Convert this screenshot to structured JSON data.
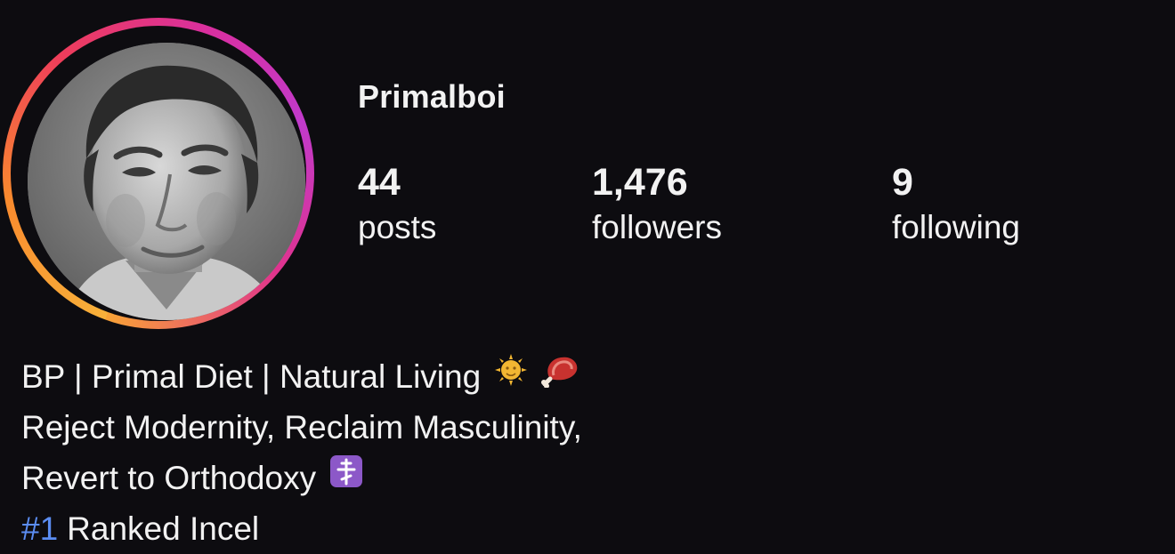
{
  "profile": {
    "username": "Primalboi",
    "avatar_icon": "profile-photo-grayscale-man",
    "story_ring_colors": [
      "#f8b13a",
      "#ee3d5a",
      "#c13acb"
    ],
    "stats": {
      "posts": {
        "value": "44",
        "label": "posts"
      },
      "followers": {
        "value": "1,476",
        "label": "followers"
      },
      "following": {
        "value": "9",
        "label": "following"
      }
    },
    "bio": {
      "line1": "BP | Primal Diet | Natural Living",
      "line1_emojis": [
        "sun-with-face-icon",
        "meat-on-bone-icon"
      ],
      "line2": "Reject Modernity, Reclaim Masculinity,",
      "line3": "Revert to Orthodoxy",
      "line3_emoji": "orthodox-cross-icon",
      "line4_hashtag": "#1",
      "line4_text": "Ranked Incel",
      "hashtag_color": "#5b8df2"
    }
  }
}
